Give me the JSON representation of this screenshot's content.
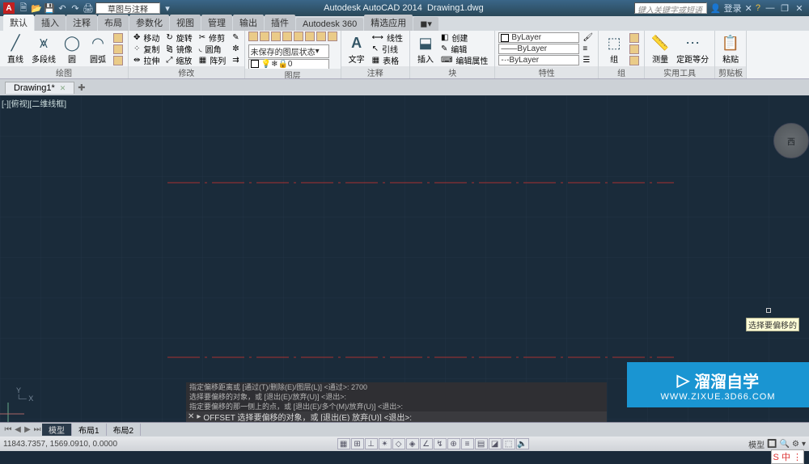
{
  "title": {
    "app": "Autodesk AutoCAD 2014",
    "doc": "Drawing1.dwg",
    "icon_char": "A"
  },
  "qat": {
    "dropdown": "草图与注释"
  },
  "titlebar": {
    "search_placeholder": "键入关键字或短语",
    "login": "登录"
  },
  "tabs": [
    "默认",
    "插入",
    "注释",
    "布局",
    "参数化",
    "视图",
    "管理",
    "输出",
    "插件",
    "Autodesk 360",
    "精选应用"
  ],
  "active_tab": 0,
  "ribbon": {
    "draw": {
      "label": "绘图",
      "items": [
        "直线",
        "多段线",
        "圆",
        "圆弧"
      ]
    },
    "modify": {
      "label": "修改",
      "left": [
        "移动",
        "复制",
        "拉伸"
      ],
      "mid": [
        "旋转",
        "镜像",
        "缩放"
      ],
      "right": [
        "修剪",
        "圆角",
        "阵列"
      ],
      "erase": "删除"
    },
    "layer": {
      "label": "图层",
      "main": "未保存的图层状态",
      "sel": "0"
    },
    "annot": {
      "label": "注释",
      "text": "文字",
      "items": [
        "线性",
        "引线",
        "表格"
      ]
    },
    "block": {
      "label": "块",
      "ins": "插入",
      "items": [
        "创建",
        "编辑",
        "编辑属性"
      ]
    },
    "props": {
      "label": "特性",
      "sel": "ByLayer",
      "lt": "ByLayer",
      "lw": "ByLayer"
    },
    "groups": {
      "label": "组",
      "g": "组"
    },
    "util": {
      "label": "实用工具",
      "m": "测量",
      "j": "定距等分"
    },
    "clip": {
      "label": "剪贴板",
      "p": "粘贴"
    }
  },
  "doc_tab": "Drawing1*",
  "canvas": {
    "topleft": "[-][俯视][二维线框]",
    "viewcube": "西",
    "tooltip": "选择要偏移的"
  },
  "cmd": {
    "h1": "指定偏移距离或 [通过(T)/删除(E)/图层(L)] <通过>: 2700",
    "h2": "选择要偏移的对象，或 [退出(E)/放弃(U)] <退出>:",
    "h3": "指定要偏移的那一侧上的点，或 [退出(E)/多个(M)/放弃(U)] <退出>:",
    "prompt": "OFFSET 选择要偏移的对象，或 [退出(E) 放弃(U)] <退出>:",
    "icon": "▸"
  },
  "layout": {
    "nav": [
      "⏮",
      "◀",
      "▶",
      "⏭"
    ],
    "tabs": [
      "模型",
      "布局1",
      "布局2"
    ],
    "active": 0
  },
  "status": {
    "coords": "11843.7357, 1569.0910, 0.0000",
    "right_text": "模型"
  },
  "watermark": {
    "top": "溜溜自学",
    "bot": "WWW.ZIXUE.3D66.COM"
  },
  "ime": "S 中 ⋮"
}
